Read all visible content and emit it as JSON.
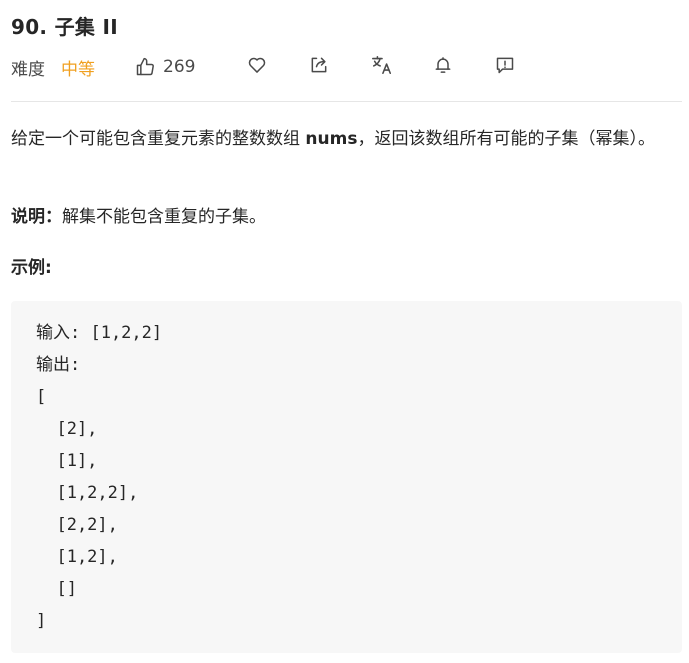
{
  "problem": {
    "title": "90. 子集 II",
    "difficulty_label": "难度",
    "difficulty_value": "中等",
    "like_count": "269",
    "icons": [
      "thumbs-up-icon",
      "heart-icon",
      "share-icon",
      "translate-icon",
      "bell-icon",
      "feedback-icon"
    ],
    "colors": {
      "difficulty": "#f0a020",
      "code_bg": "#f7f7f7",
      "divider": "#e6e6e6"
    }
  },
  "description": {
    "p1_before": "给定一个可能包含重复元素的整数数组 ",
    "p1_bold": "nums",
    "p1_after": "，返回该数组所有可能的子集（幂集）。",
    "note_label": "说明：",
    "note_text": "解集不能包含重复的子集。",
    "example_label": "示例:"
  },
  "example": {
    "code": "输入: [1,2,2]\n输出:\n[\n  [2],\n  [1],\n  [1,2,2],\n  [2,2],\n  [1,2],\n  []\n]"
  }
}
